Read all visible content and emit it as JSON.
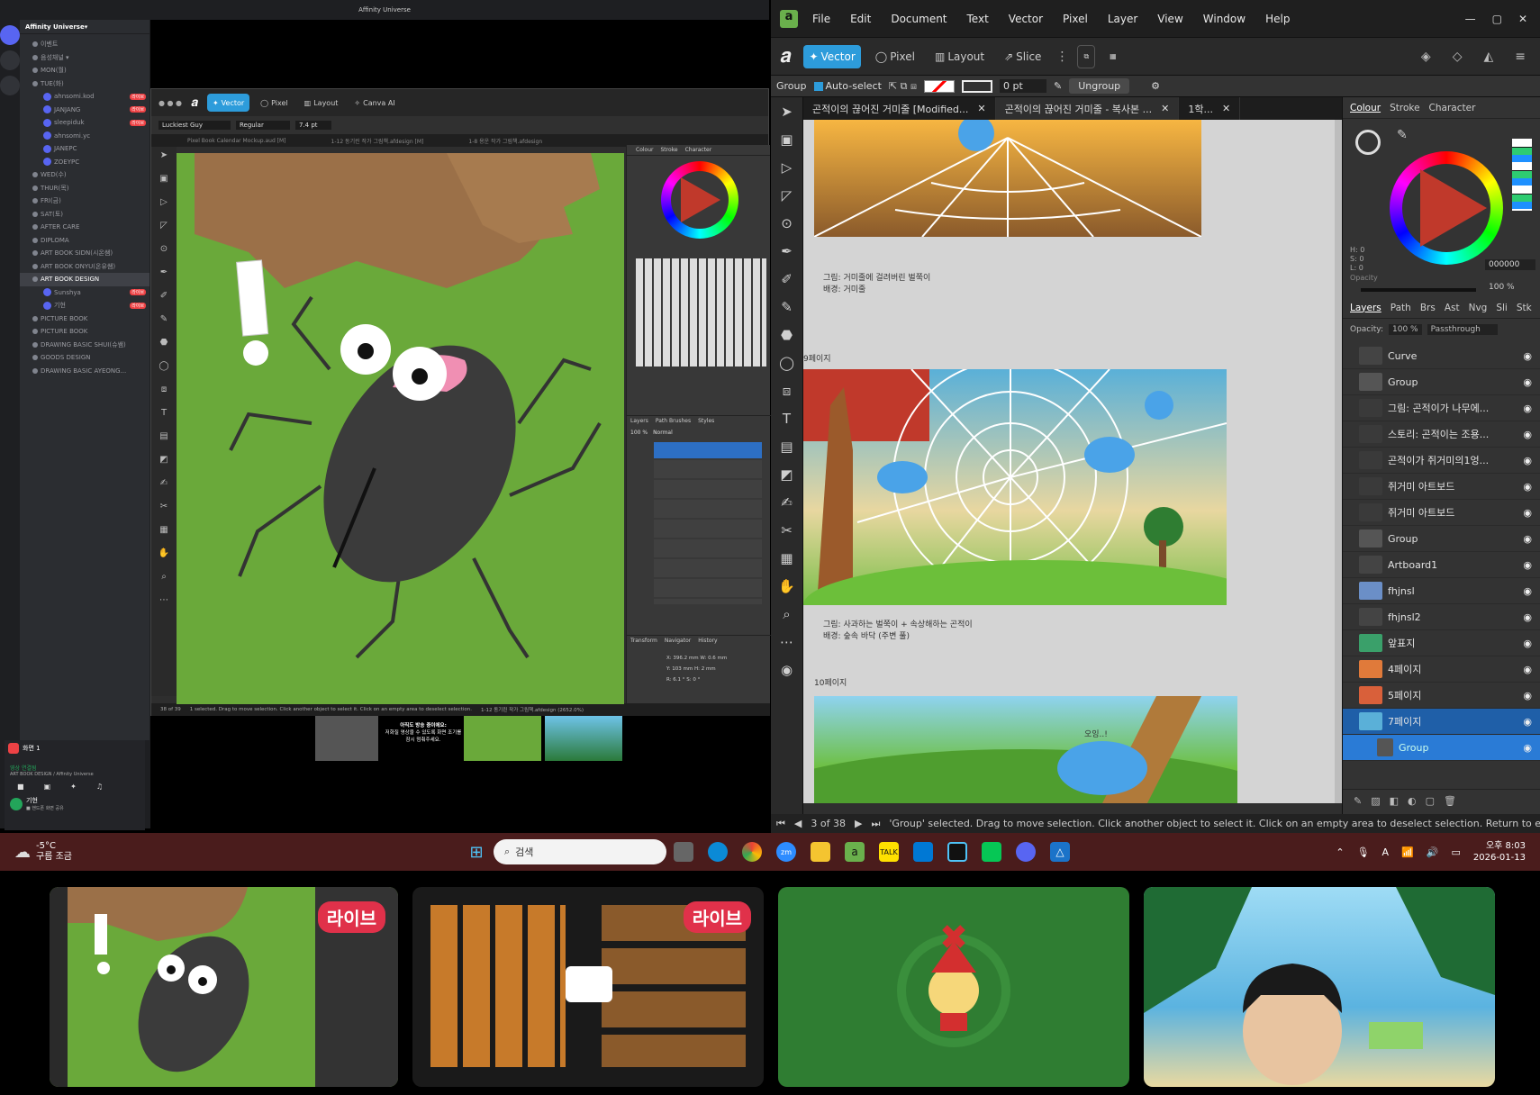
{
  "left_window": {
    "title": "Affinity Universe",
    "discord": {
      "server_name": "Affinity Universe",
      "channels": [
        {
          "label": "이벤트",
          "type": "header"
        },
        {
          "label": "음성채널 ▾",
          "type": "category"
        },
        {
          "label": "MON(월)",
          "type": "channel"
        },
        {
          "label": "TUE(화)",
          "type": "channel"
        },
        {
          "label": "ahnsomi.kod",
          "type": "user",
          "live": "라이브"
        },
        {
          "label": "JANJANG",
          "type": "user",
          "live": "라이브"
        },
        {
          "label": "sleepiduk",
          "type": "user",
          "live": "라이브"
        },
        {
          "label": "ahnsomi.yc",
          "type": "user",
          "live": ""
        },
        {
          "label": "JANEPC",
          "type": "user",
          "live": ""
        },
        {
          "label": "ZOEYPC",
          "type": "user",
          "live": ""
        },
        {
          "label": "WED(수)",
          "type": "channel"
        },
        {
          "label": "THUR(목)",
          "type": "channel"
        },
        {
          "label": "FRI(금)",
          "type": "channel"
        },
        {
          "label": "SAT(토)",
          "type": "channel"
        },
        {
          "label": "AFTER CARE",
          "type": "channel"
        },
        {
          "label": "DIPLOMA",
          "type": "channel"
        },
        {
          "label": "ART BOOK SIDN(시온쌤)",
          "type": "channel"
        },
        {
          "label": "ART BOOK ONYU(온유쌤)",
          "type": "channel"
        },
        {
          "label": "ART BOOK DESIGN",
          "type": "channel",
          "selected": true
        },
        {
          "label": "Sunshya",
          "type": "user",
          "live": "라이브"
        },
        {
          "label": "기현",
          "type": "user",
          "live": "라이브"
        },
        {
          "label": "PICTURE BOOK",
          "type": "channel"
        },
        {
          "label": "PICTURE BOOK",
          "type": "channel"
        },
        {
          "label": "DRAWING BASIC SHUI(슈쌤)",
          "type": "channel"
        },
        {
          "label": "GOODS DESIGN",
          "type": "channel"
        },
        {
          "label": "DRAWING BASIC AYEONG...",
          "type": "channel"
        }
      ],
      "voice_status": "화면 1",
      "voice_connected": "영상 연결됨",
      "voice_sub": "ART BOOK DESIGN / Affinity Universe",
      "user_name": "기현",
      "user_status": "■ 핸드폰 화면 공유"
    },
    "affinity": {
      "modes": [
        "Vector",
        "Pixel",
        "Layout",
        "Canva AI"
      ],
      "font": "Luckiest Guy",
      "weight": "Regular",
      "size": "7.4 pt",
      "tabs": [
        "Pixel Book Calendar Mockup.aud [M]",
        "1-12 동기린 작가 그림책.afdesign [M]",
        "1-8 용운 작가 그림책.afdesign"
      ],
      "page": "38 of 39",
      "status": "1 selected. Drag to move selection. Click another object to select it. Click on an empty area to deselect selection.",
      "file_status": "1-12 동기린 작가 그림책.afdesign (2652.0%)",
      "panel_tabs": [
        "Colour",
        "Stroke",
        "Character"
      ],
      "layer_tabs": [
        "Layers",
        "Path Brushes",
        "Styles"
      ],
      "opacity": "100 %",
      "blend": "Normal",
      "transform_tabs": [
        "Transform",
        "Navigator",
        "History"
      ],
      "transform": {
        "x": "396.2 mm",
        "y": "103 mm",
        "w": "0.6 mm",
        "h": "2 mm",
        "r": "6.1 °",
        "s": "0 °"
      }
    },
    "previews": {
      "msg_title": "아직도 방송 중이에요:",
      "msg_body": "저화질 영상을 수 있도록 화면 조기를 잠시 멈춰주세요.",
      "live": "라이브"
    }
  },
  "right_window": {
    "menu": [
      "File",
      "Edit",
      "Document",
      "Text",
      "Vector",
      "Pixel",
      "Layer",
      "View",
      "Window",
      "Help"
    ],
    "modes": [
      "Vector",
      "Pixel",
      "Layout",
      "Slice"
    ],
    "context": {
      "group": "Group",
      "autoselect": "Auto-select",
      "stroke": "0 pt",
      "ungroup": "Ungroup"
    },
    "tabs": [
      "곤적이의 끊어진 거미줄 [Modified...",
      "곤적이의 끊어진 거미줄 - 복사본 ...",
      "1학..."
    ],
    "doc_captions": [
      {
        "line1": "그림: 거미줄에 걸려버린 벌쭉이",
        "line2": "배경: 거미줄"
      },
      {
        "line1": "그림: 사과하는 벌쭉이 + 속상해하는 곤적이",
        "line2": "배경: 숲속 바닥 (주변 풀)"
      }
    ],
    "page_labels": [
      "9페이지",
      "10페이지"
    ],
    "scene_text": "오잉..!",
    "panel_tabs": [
      "Colour",
      "Stroke",
      "Character"
    ],
    "hsl": {
      "h": "H: 0",
      "s": "S: 0",
      "l": "L: 0",
      "hex": "000000",
      "opacity_label": "Opacity",
      "opacity": "100 %"
    },
    "layers_tabs": [
      "Layers",
      "Path",
      "Brs",
      "Ast",
      "Nvg",
      "Sli",
      "Stk"
    ],
    "layers_opacity": "100 %",
    "blend": "Passthrough",
    "layers": [
      {
        "name": "Curve",
        "state": ""
      },
      {
        "name": "Group",
        "state": ""
      },
      {
        "name": "그림: 곤적이가 나무에...",
        "state": ""
      },
      {
        "name": "스토리: 곤적이는 조용...",
        "state": ""
      },
      {
        "name": "곤적이가 쥐거미의1엉...",
        "state": ""
      },
      {
        "name": "쥐거미 아트보드",
        "state": ""
      },
      {
        "name": "쥐거미 아트보드",
        "state": ""
      },
      {
        "name": "Group",
        "state": ""
      },
      {
        "name": "Artboard1",
        "state": ""
      },
      {
        "name": "fhjnsl",
        "state": ""
      },
      {
        "name": "fhjnsl2",
        "state": ""
      },
      {
        "name": "앞표지",
        "state": ""
      },
      {
        "name": "4페이지",
        "state": ""
      },
      {
        "name": "5페이지",
        "state": ""
      },
      {
        "name": "7페이지",
        "state": "selected"
      },
      {
        "name": "Group",
        "state": "child"
      }
    ],
    "status": {
      "page": "3 of 38",
      "msg": "'Group' selected. Drag to move selection. Click another object to select it. Click on an empty area to deselect selection. Return to e"
    }
  },
  "taskbar": {
    "weather_temp": "-5°C",
    "weather_desc": "구름 조금",
    "search": "검색",
    "time": "오후 8:03",
    "date": "2026-01-13",
    "lang": "A"
  },
  "streams": {
    "live_label": "라이브"
  },
  "colors": {
    "affinity_blue": "#2d9cdb",
    "layer_select": "#1f5fa8",
    "taskbar": "#4a1c1c",
    "live_red": "#e0314a"
  }
}
